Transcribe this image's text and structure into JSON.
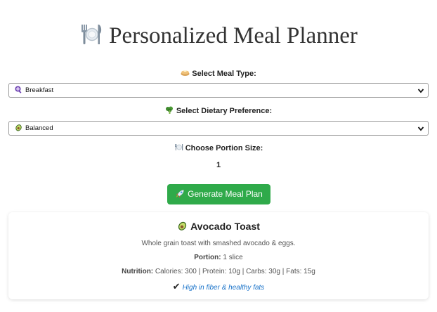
{
  "app": {
    "title": "Personalized Meal Planner",
    "title_icon": "plate-cutlery-icon"
  },
  "meal_type": {
    "label": "Select Meal Type:",
    "label_icon": "pancake-icon",
    "selected": "Breakfast",
    "selected_icon": "magnifier-icon"
  },
  "dietary": {
    "label": "Select Dietary Preference:",
    "label_icon": "broccoli-icon",
    "selected": "Balanced",
    "selected_icon": "avocado-icon"
  },
  "portion": {
    "label": "Choose Portion Size:",
    "label_icon": "plate-cutlery-icon",
    "value": "1"
  },
  "generate": {
    "label": "Generate Meal Plan",
    "icon": "rocket-icon",
    "color": "#2faa4a"
  },
  "result": {
    "title": "Avocado Toast",
    "title_icon": "avocado-icon",
    "description": "Whole grain toast with smashed avocado & eggs.",
    "portion_label": "Portion:",
    "portion_value": "1 slice",
    "nutrition_label": "Nutrition:",
    "nutrition_value": "Calories: 300 | Protein: 10g | Carbs: 30g | Fats: 15g",
    "benefit_icon": "check-mark-icon",
    "benefit_mark": "✔",
    "benefit": "High in fiber & healthy fats",
    "benefit_color": "#1a73c9"
  }
}
